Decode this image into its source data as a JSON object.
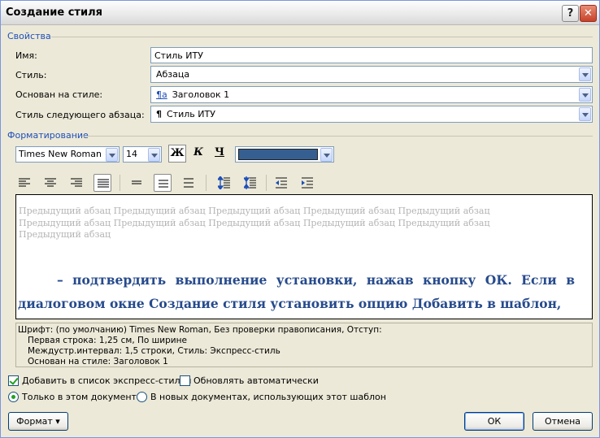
{
  "window": {
    "title": "Создание стиля"
  },
  "titlebar": {
    "help_icon": "question-icon",
    "close_icon": "close-icon"
  },
  "properties": {
    "header": "Свойства",
    "name_label": "Имя:",
    "name_value": "Стиль ИТУ",
    "style_label": "Стиль:",
    "style_value": "Абзаца",
    "based_label": "Основан на стиле:",
    "based_icon": "¶a",
    "based_value": "Заголовок 1",
    "next_label": "Стиль следующего абзаца:",
    "next_icon": "¶",
    "next_value": "Стиль ИТУ"
  },
  "formatting": {
    "header": "Форматирование",
    "font": "Times New Roman",
    "size": "14",
    "bold": "Ж",
    "italic": "К",
    "underline": "Ч",
    "color": "#365f91"
  },
  "paragraph_tools": [
    {
      "name": "align-left-icon",
      "pressed": false
    },
    {
      "name": "align-center-icon",
      "pressed": false
    },
    {
      "name": "align-right-icon",
      "pressed": false
    },
    {
      "name": "align-justify-icon",
      "pressed": true
    },
    {
      "name": "single-spacing-icon",
      "pressed": false
    },
    {
      "name": "one-half-spacing-icon",
      "pressed": true
    },
    {
      "name": "double-spacing-icon",
      "pressed": false
    },
    {
      "name": "increase-paragraph-spacing-icon",
      "pressed": false
    },
    {
      "name": "decrease-paragraph-spacing-icon",
      "pressed": false
    },
    {
      "name": "decrease-indent-icon",
      "pressed": false
    },
    {
      "name": "increase-indent-icon",
      "pressed": false
    }
  ],
  "preview": {
    "previous_paragraph": "Предыдущий абзац Предыдущий абзац Предыдущий абзац Предыдущий абзац Предыдущий абзац Предыдущий абзац Предыдущий абзац Предыдущий абзац Предыдущий абзац Предыдущий абзац Предыдущий абзац",
    "line1": "– подтвердить выполнение установки, нажав кнопку ОК. Если в",
    "line2": "диалоговом окне Создание стиля установить опцию Добавить в шаблон,"
  },
  "description": {
    "line1": "Шрифт: (по умолчанию) Times New Roman, Без проверки правописания, Отступ:",
    "line2": "Первая строка:  1,25 см, По ширине",
    "line3": "Междустр.интервал:  1,5 строки, Стиль: Экспресс-стиль",
    "line4": "Основан на стиле: Заголовок 1"
  },
  "options": {
    "add_quick_styles": "Добавить в список экспресс-стилей",
    "add_quick_styles_checked": true,
    "auto_update": "Обновлять автоматически",
    "auto_update_checked": false,
    "only_this_doc": "Только в этом документе",
    "new_docs": "В новых документах, использующих этот шаблон",
    "selected_scope": "only_this_doc"
  },
  "buttons": {
    "format": "Формат ▾",
    "ok": "ОК",
    "cancel": "Отмена"
  }
}
